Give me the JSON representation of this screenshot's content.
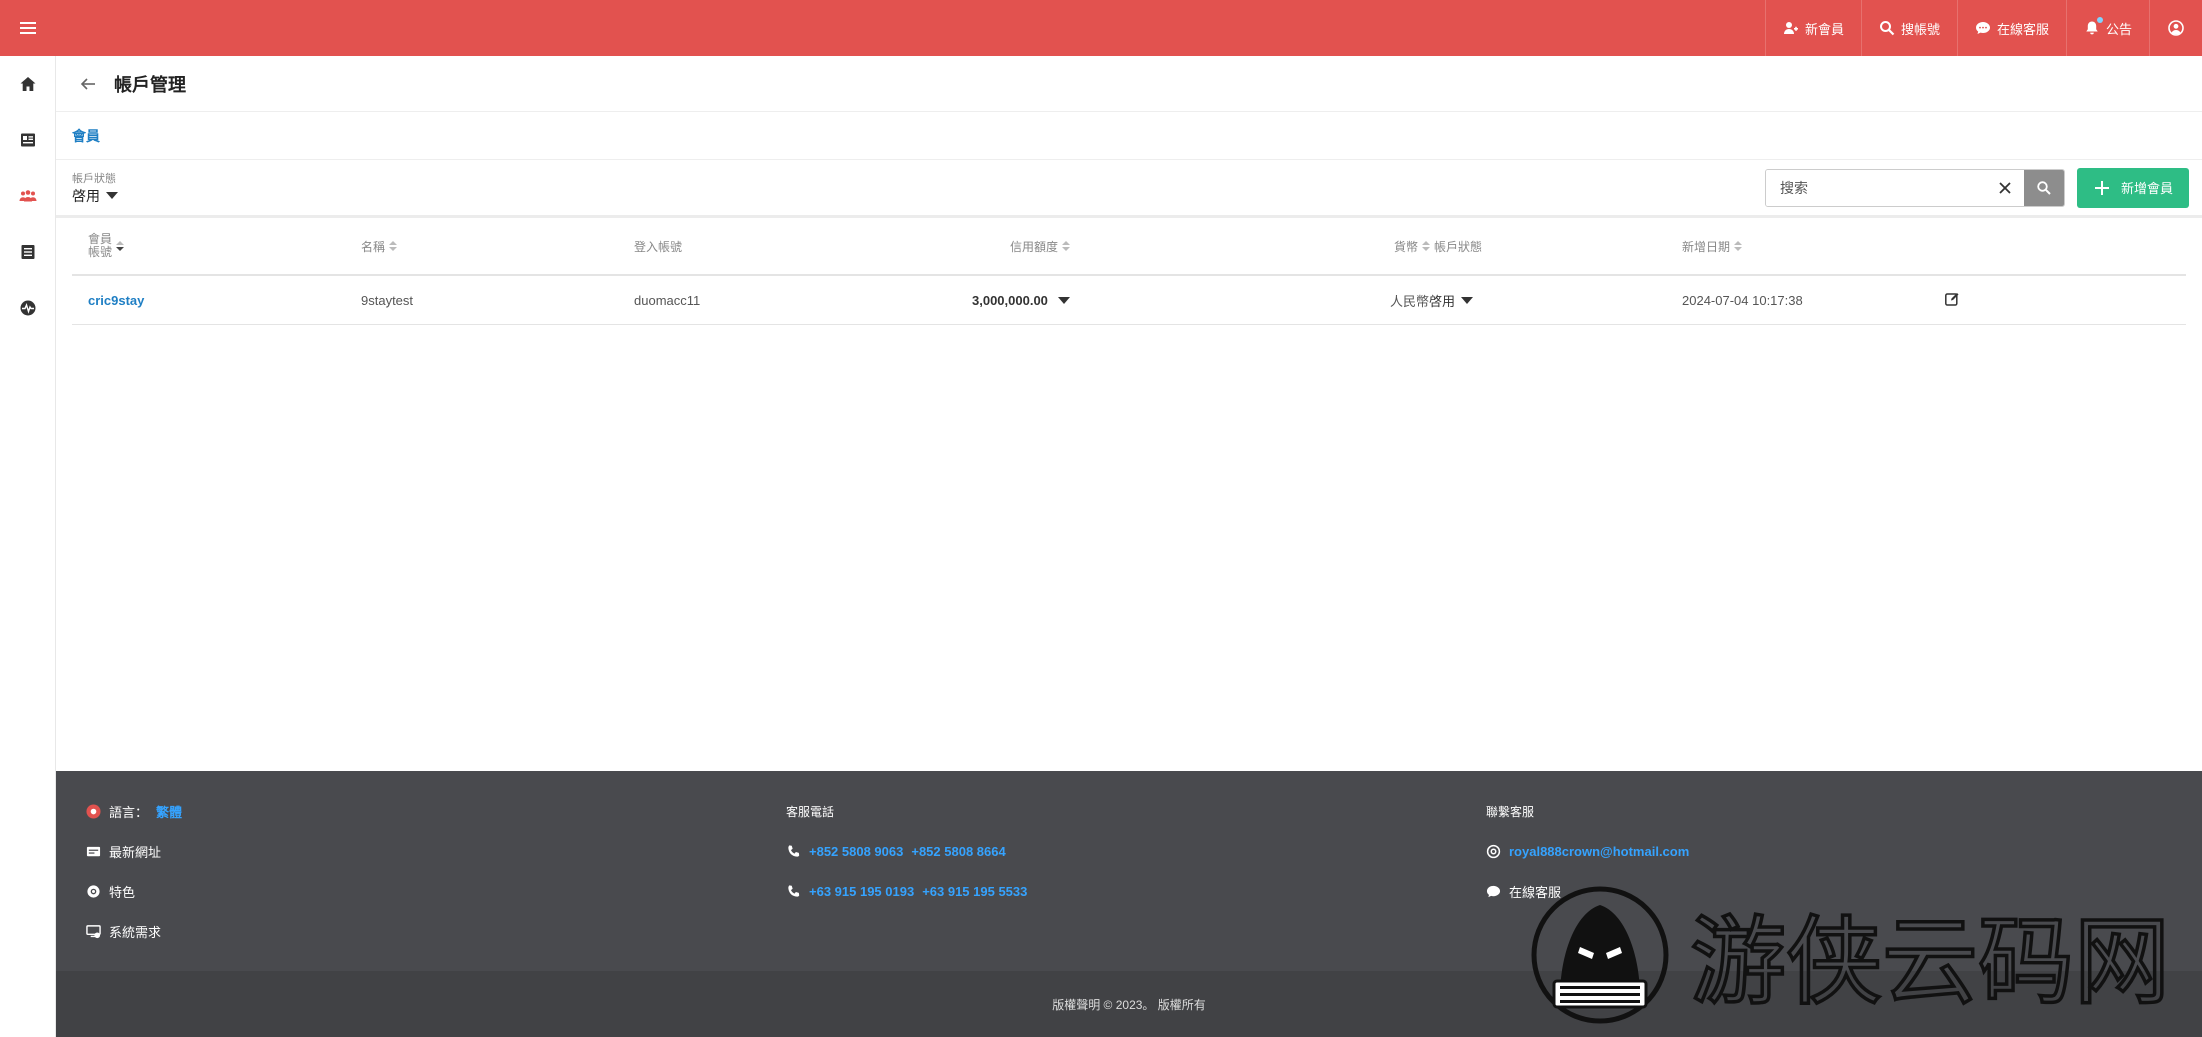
{
  "topbar": {
    "items": [
      {
        "label": "新會員",
        "icon": "add-user-icon"
      },
      {
        "label": "搜帳號",
        "icon": "search-icon"
      },
      {
        "label": "在線客服",
        "icon": "chat-icon"
      },
      {
        "label": "公告",
        "icon": "bell-icon"
      }
    ],
    "avatar_icon": "user-circle-icon",
    "colors": {
      "bar": "#e2524f"
    }
  },
  "sidebar": {
    "icons": [
      "home-icon",
      "id-card-icon",
      "users-icon",
      "list-icon",
      "pulse-icon"
    ]
  },
  "page": {
    "title": "帳戶管理",
    "tab": "會員",
    "filter": {
      "label": "帳戶狀態",
      "value": "啓用"
    },
    "search": {
      "placeholder": "搜索"
    },
    "add_button": "新增會員"
  },
  "table": {
    "headers": {
      "account_line1": "會員",
      "account_line2": "帳號",
      "name": "名稱",
      "login": "登入帳號",
      "credit": "信用額度",
      "currency": "貨幣",
      "status": "帳戶狀態",
      "created": "新增日期"
    },
    "rows": [
      {
        "account": "cric9stay",
        "name": "9staytest",
        "login": "duomacc11",
        "credit": "3,000,000.00",
        "currency": "人民幣",
        "status": "啓用",
        "created": "2024-07-04 10:17:38"
      }
    ]
  },
  "footer": {
    "col1": {
      "language_label": "語言：",
      "language_value": "繁體",
      "latest_url": "最新網址",
      "features": "特色",
      "requirements": "系統需求"
    },
    "col2": {
      "heading": "客服電話",
      "phones1": [
        "+852 5808 9063",
        "+852 5808 8664"
      ],
      "phones2": [
        "+63 915 195 0193",
        "+63 915 195 5533"
      ]
    },
    "col3": {
      "heading": "聯繫客服",
      "email": "royal888crown@hotmail.com",
      "online_service": "在線客服"
    },
    "copyright": "版權聲明 © 2023。 版權所有",
    "colors": {
      "bg": "#494a4e",
      "link": "#35a3ff"
    }
  },
  "watermark": {
    "text": "游侠云码网"
  }
}
